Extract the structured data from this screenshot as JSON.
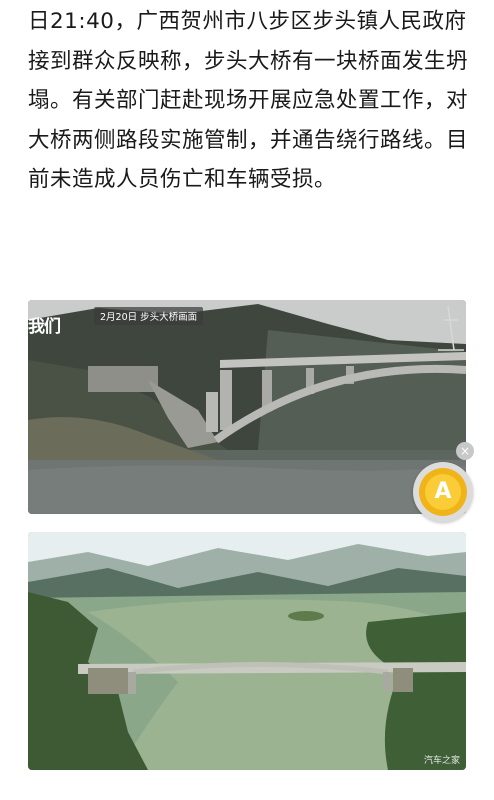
{
  "article": {
    "paragraph": "日21:40，广西贺州市八步区步头镇人民政府接到群众反映称，步头大桥有一块桥面发生坍塌。有关部门赶赴现场开展应急处置工作，对大桥两侧路段实施管制，并通告绕行路线。目前未造成人员伤亡和车辆受损。"
  },
  "photo1": {
    "logo": "我们",
    "caption": "2月20日 步头大桥画面"
  },
  "photo2": {
    "watermark": "汽车之家"
  },
  "floating_widget": {
    "close_glyph": "×",
    "coin_letter": "A",
    "colors": {
      "coin_outer": "#f0b418",
      "coin_inner": "#f9cc38"
    }
  }
}
